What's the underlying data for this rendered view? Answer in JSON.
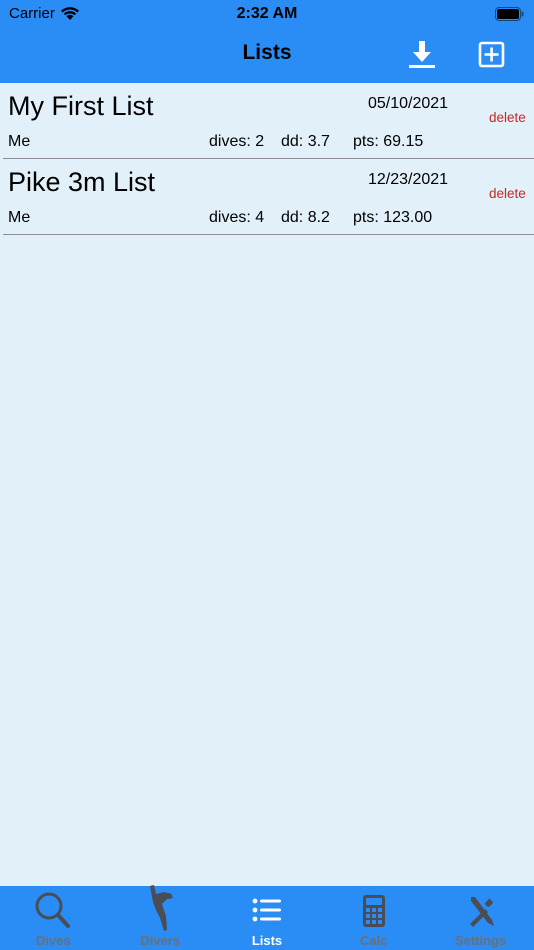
{
  "status_bar": {
    "carrier": "Carrier",
    "time": "2:32 AM"
  },
  "nav": {
    "title": "Lists"
  },
  "lists": [
    {
      "title": "My First List",
      "date": "05/10/2021",
      "delete_label": "delete",
      "owner": "Me",
      "dives": "dives: 2",
      "dd": "dd: 3.7",
      "pts": "pts: 69.15"
    },
    {
      "title": "Pike 3m List",
      "date": "12/23/2021",
      "delete_label": "delete",
      "owner": "Me",
      "dives": "dives: 4",
      "dd": "dd: 8.2",
      "pts": "pts: 123.00"
    }
  ],
  "tabs": [
    {
      "label": "Dives",
      "icon": "search-icon"
    },
    {
      "label": "Divers",
      "icon": "diver-icon"
    },
    {
      "label": "Lists",
      "icon": "list-icon"
    },
    {
      "label": "Calc",
      "icon": "calculator-icon"
    },
    {
      "label": "Settings",
      "icon": "tools-icon"
    }
  ],
  "colors": {
    "accent": "#2a8cf5",
    "background": "#e2f0f9",
    "delete": "#c62828",
    "tab_inactive": "#6b6f75"
  }
}
